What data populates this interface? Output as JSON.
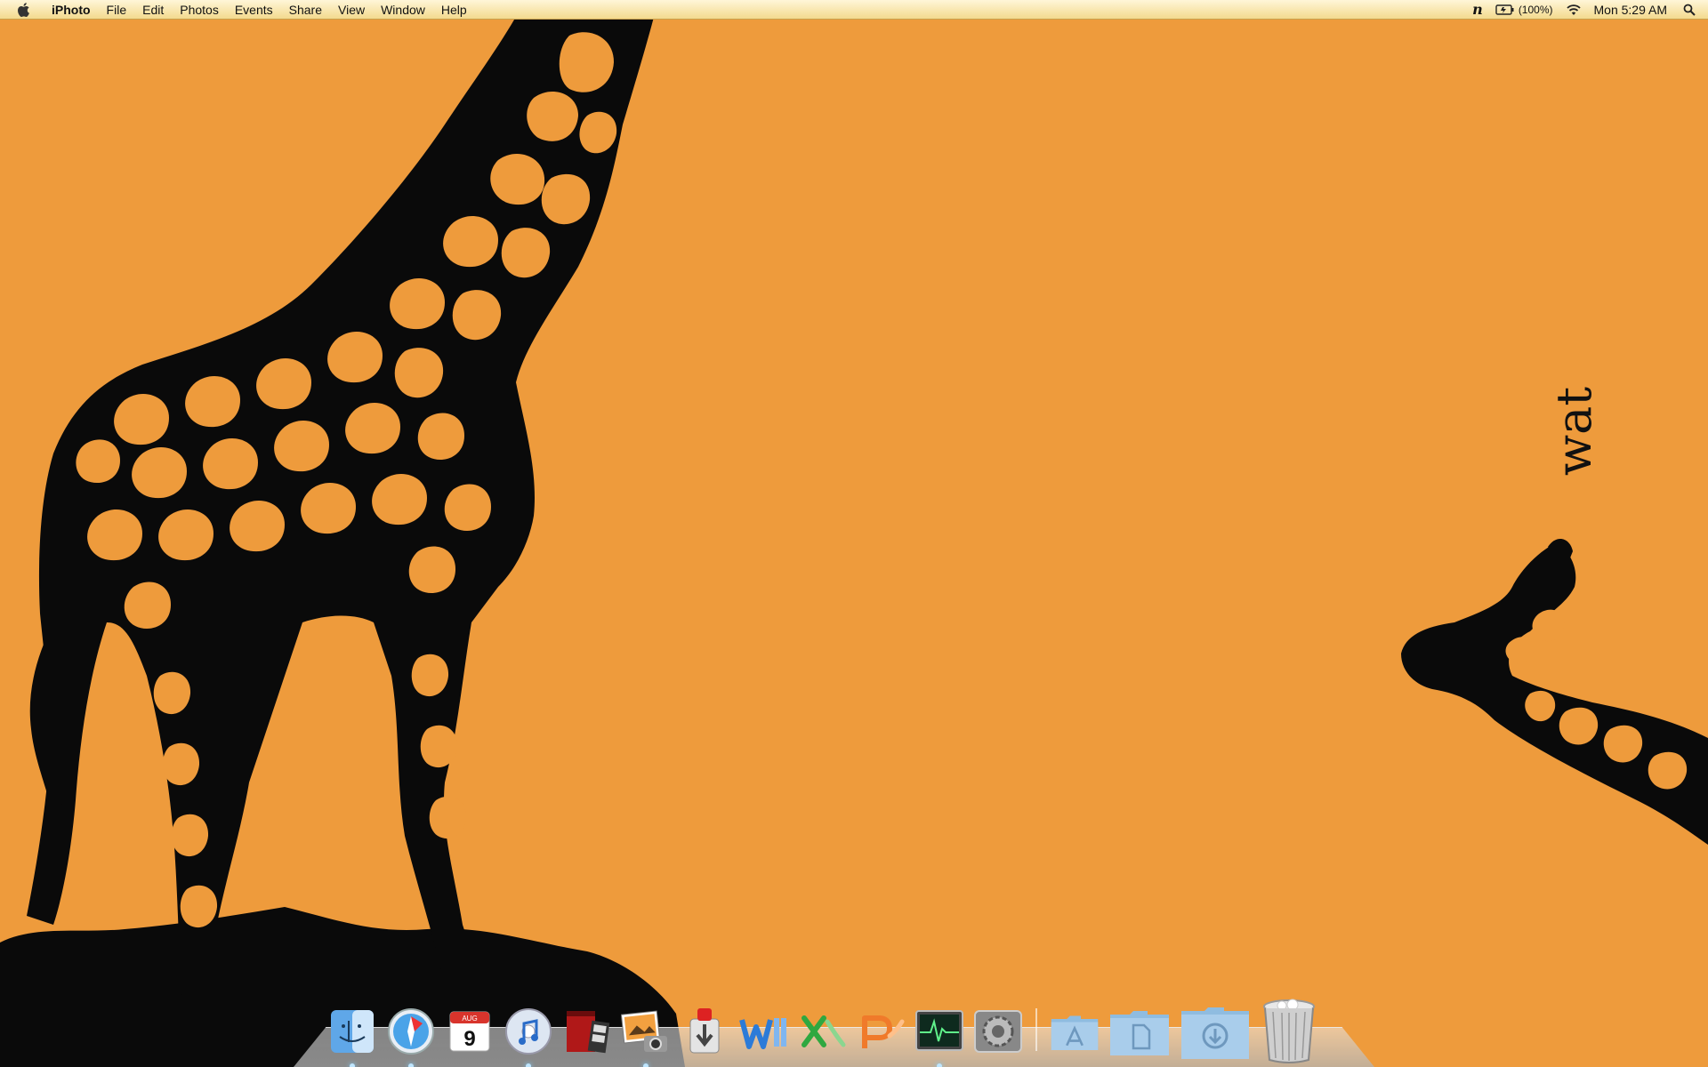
{
  "menubar": {
    "app_name": "iPhoto",
    "menus": [
      "File",
      "Edit",
      "Photos",
      "Events",
      "Share",
      "View",
      "Window",
      "Help"
    ],
    "status": {
      "battery_text": "(100%)",
      "clock": "Mon 5:29 AM"
    }
  },
  "desktop": {
    "wallpaper_text": "wat",
    "background_color": "#EE9B3C"
  },
  "dock": {
    "items": [
      {
        "name": "Finder",
        "icon": "finder-icon"
      },
      {
        "name": "Safari",
        "icon": "safari-icon"
      },
      {
        "name": "iCal",
        "icon": "calendar-icon",
        "label": "9",
        "month": "AUG"
      },
      {
        "name": "iTunes",
        "icon": "itunes-icon"
      },
      {
        "name": "Photo Booth",
        "icon": "photo-booth-icon"
      },
      {
        "name": "iPhoto",
        "icon": "iphoto-icon"
      },
      {
        "name": "Transmission",
        "icon": "transmission-icon"
      },
      {
        "name": "Microsoft Word",
        "icon": "word-icon"
      },
      {
        "name": "Microsoft Excel",
        "icon": "excel-icon"
      },
      {
        "name": "Microsoft PowerPoint",
        "icon": "powerpoint-icon"
      },
      {
        "name": "Activity Monitor",
        "icon": "activity-monitor-icon"
      },
      {
        "name": "System Preferences",
        "icon": "system-preferences-icon"
      },
      {
        "name": "Applications",
        "icon": "applications-folder-icon"
      },
      {
        "name": "Documents",
        "icon": "documents-folder-icon"
      },
      {
        "name": "Downloads",
        "icon": "downloads-folder-icon"
      },
      {
        "name": "Trash",
        "icon": "trash-icon"
      }
    ]
  }
}
